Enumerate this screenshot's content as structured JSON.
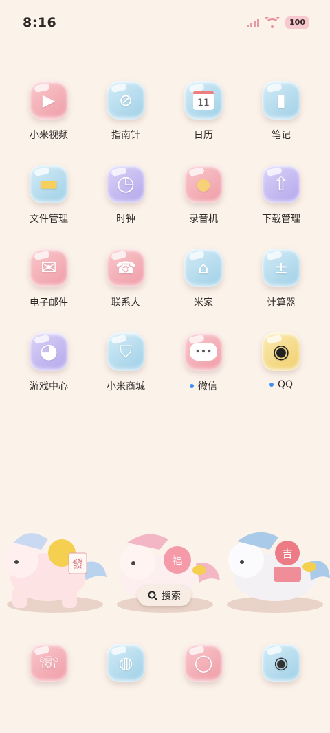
{
  "status": {
    "time": "8:16",
    "battery": "100"
  },
  "apps": [
    {
      "label": "小米视频",
      "icon": "video-icon",
      "color": "pink",
      "glyph": "▶",
      "dot": false
    },
    {
      "label": "指南针",
      "icon": "compass-icon",
      "color": "blue",
      "glyph": "⊘",
      "dot": false
    },
    {
      "label": "日历",
      "icon": "calendar-icon",
      "color": "blue",
      "glyph": "11",
      "dot": false
    },
    {
      "label": "笔记",
      "icon": "notes-icon",
      "color": "blue",
      "glyph": "▮",
      "dot": false
    },
    {
      "label": "文件管理",
      "icon": "folder-icon",
      "color": "blue",
      "glyph": "▬",
      "dot": false
    },
    {
      "label": "时钟",
      "icon": "clock-icon",
      "color": "purple",
      "glyph": "◷",
      "dot": false
    },
    {
      "label": "录音机",
      "icon": "microphone-icon",
      "color": "pink",
      "glyph": "●",
      "dot": false
    },
    {
      "label": "下载管理",
      "icon": "download-icon",
      "color": "purple",
      "glyph": "⇧",
      "dot": false
    },
    {
      "label": "电子邮件",
      "icon": "mail-icon",
      "color": "pink",
      "glyph": "✉",
      "dot": false
    },
    {
      "label": "联系人",
      "icon": "contacts-icon",
      "color": "pink",
      "glyph": "☎",
      "dot": false
    },
    {
      "label": "米家",
      "icon": "mijia-icon",
      "color": "blue",
      "glyph": "⌂",
      "dot": false
    },
    {
      "label": "计算器",
      "icon": "calculator-icon",
      "color": "blue",
      "glyph": "±",
      "dot": false
    },
    {
      "label": "游戏中心",
      "icon": "game-icon",
      "color": "purple",
      "glyph": "◕",
      "dot": false
    },
    {
      "label": "小米商城",
      "icon": "shopping-bag-icon",
      "color": "blue",
      "glyph": "⛉",
      "dot": false
    },
    {
      "label": "微信",
      "icon": "wechat-icon",
      "color": "pink",
      "glyph": "•••",
      "dot": true
    },
    {
      "label": "QQ",
      "icon": "qq-penguin-icon",
      "color": "yellow",
      "glyph": "◉",
      "dot": true
    }
  ],
  "widget": {
    "search_label": "搜索",
    "badge_left": "發",
    "badge_mid": "福",
    "badge_right": "吉"
  },
  "dock": [
    {
      "icon": "phone-icon",
      "color": "pink",
      "glyph": "☏"
    },
    {
      "icon": "browser-icon",
      "color": "blue",
      "glyph": "◍"
    },
    {
      "icon": "messages-icon",
      "color": "pink",
      "glyph": "◯"
    },
    {
      "icon": "camera-icon",
      "color": "blue",
      "glyph": "◉"
    }
  ]
}
